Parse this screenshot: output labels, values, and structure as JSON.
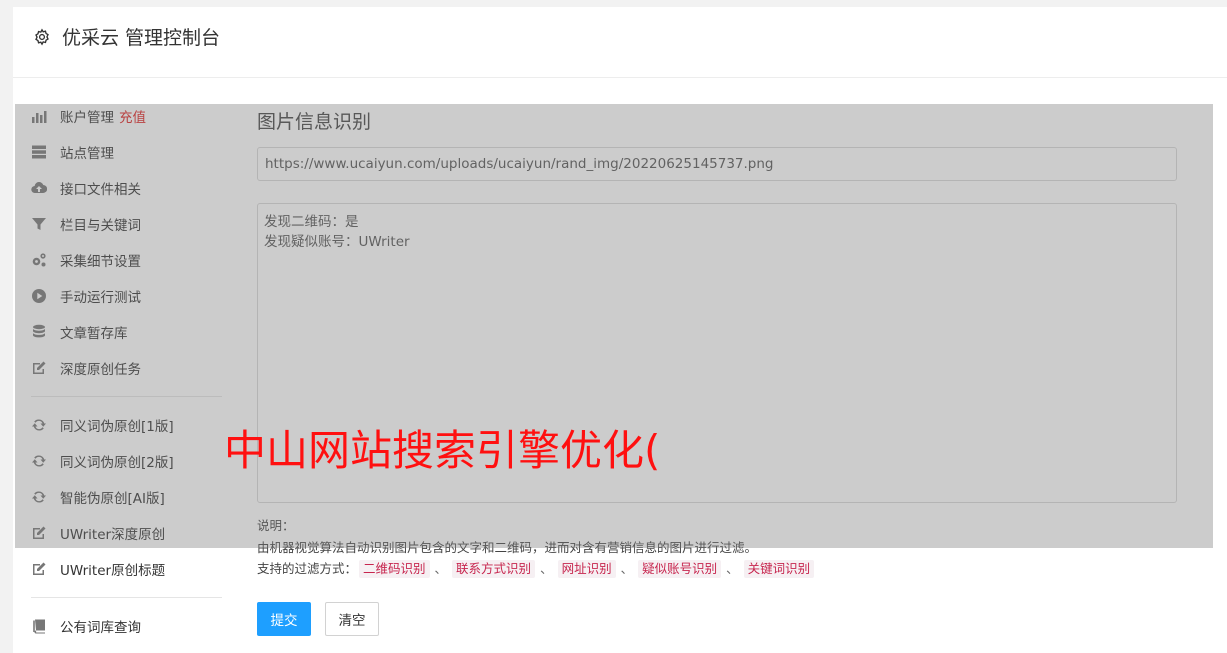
{
  "header": {
    "title": "优采云 管理控制台",
    "icon": "gear-icon"
  },
  "sidebar": {
    "items": [
      {
        "label": "账户管理",
        "badge": "充值",
        "icon": "bar-chart-icon"
      },
      {
        "label": "站点管理",
        "icon": "server-icon"
      },
      {
        "label": "接口文件相关",
        "icon": "cloud-upload-icon"
      },
      {
        "label": "栏目与关键词",
        "icon": "filter-icon"
      },
      {
        "label": "采集细节设置",
        "icon": "cogs-icon"
      },
      {
        "label": "手动运行测试",
        "icon": "play-circle-icon"
      },
      {
        "label": "文章暂存库",
        "icon": "database-icon"
      },
      {
        "label": "深度原创任务",
        "icon": "edit-icon"
      },
      {
        "label": "同义词伪原创[1版]",
        "icon": "refresh-icon"
      },
      {
        "label": "同义词伪原创[2版]",
        "icon": "refresh-icon"
      },
      {
        "label": "智能伪原创[AI版]",
        "icon": "refresh-icon"
      },
      {
        "label": "UWriter深度原创",
        "icon": "edit-icon"
      },
      {
        "label": "UWriter原创标题",
        "icon": "edit-icon"
      },
      {
        "label": "公有词库查询",
        "icon": "book-icon"
      }
    ]
  },
  "main": {
    "section_title": "图片信息识别",
    "url_value": "https://www.ucaiyun.com/uploads/ucaiyun/rand_img/20220625145737.png",
    "result_lines": [
      "发现二维码：是",
      "发现疑似账号：UWriter"
    ],
    "notes_label": "说明：",
    "notes_text": "由机器视觉算法自动识别图片包含的文字和二维码，进而对含有营销信息的图片进行过滤。",
    "filters_label": "支持的过滤方式：",
    "filters": [
      "二维码识别",
      "联系方式识别",
      "网址识别",
      "疑似账号识别",
      "关键词识别"
    ],
    "filter_sep": "、",
    "submit_label": "提交",
    "clear_label": "清空"
  },
  "overlay": {
    "text": "中山网站搜索引擎优化("
  },
  "colors": {
    "primary": "#1e9fff",
    "badge": "#e02020",
    "tag_text": "#c7254e",
    "overlay_text": "#ff1010"
  }
}
